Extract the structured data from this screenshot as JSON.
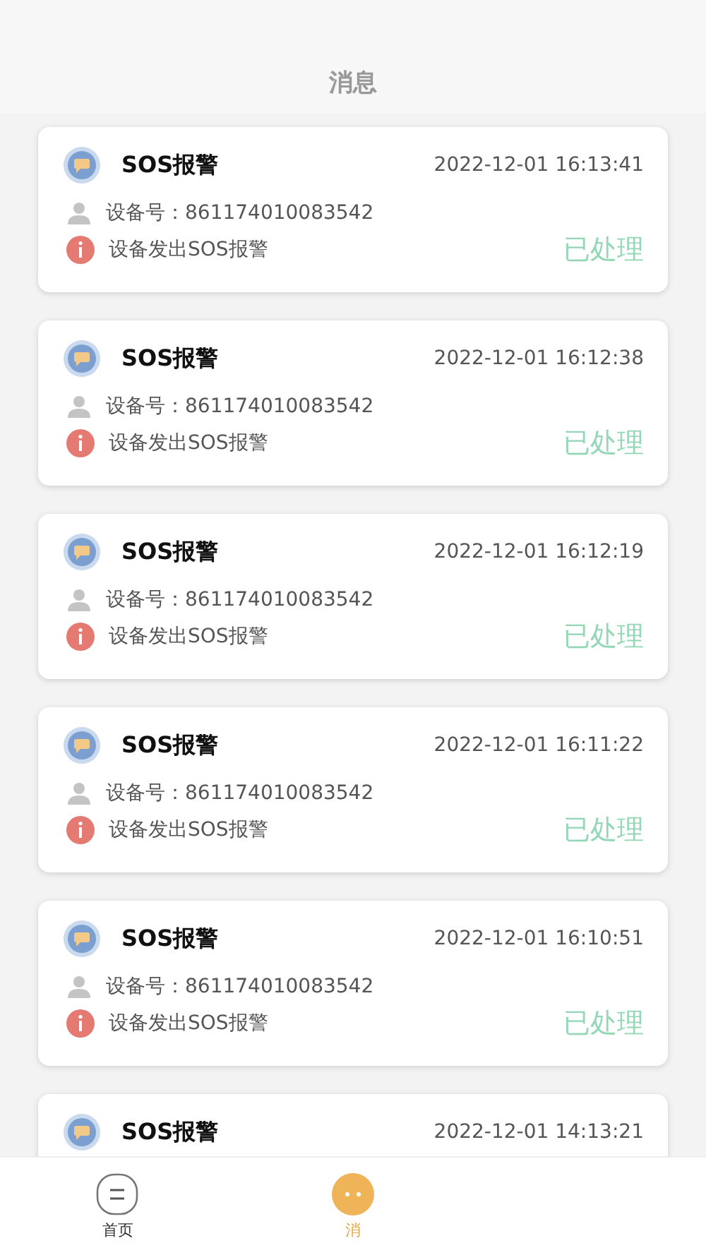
{
  "header": {
    "title": "消息"
  },
  "messages": [
    {
      "title": "SOS报警",
      "time": "2022-12-01 16:13:41",
      "device": "设备号：861174010083542",
      "detail": "设备发出SOS报警",
      "status": "已处理"
    },
    {
      "title": "SOS报警",
      "time": "2022-12-01 16:12:38",
      "device": "设备号：861174010083542",
      "detail": "设备发出SOS报警",
      "status": "已处理"
    },
    {
      "title": "SOS报警",
      "time": "2022-12-01 16:12:19",
      "device": "设备号：861174010083542",
      "detail": "设备发出SOS报警",
      "status": "已处理"
    },
    {
      "title": "SOS报警",
      "time": "2022-12-01 16:11:22",
      "device": "设备号：861174010083542",
      "detail": "设备发出SOS报警",
      "status": "已处理"
    },
    {
      "title": "SOS报警",
      "time": "2022-12-01 16:10:51",
      "device": "设备号：861174010083542",
      "detail": "设备发出SOS报警",
      "status": "已处理"
    },
    {
      "title": "SOS报警",
      "time": "2022-12-01 14:13:21"
    }
  ],
  "tabs": [
    {
      "label": "首页",
      "kind": "home",
      "selected": false
    },
    {
      "label": "消",
      "kind": "message",
      "selected": true
    }
  ]
}
